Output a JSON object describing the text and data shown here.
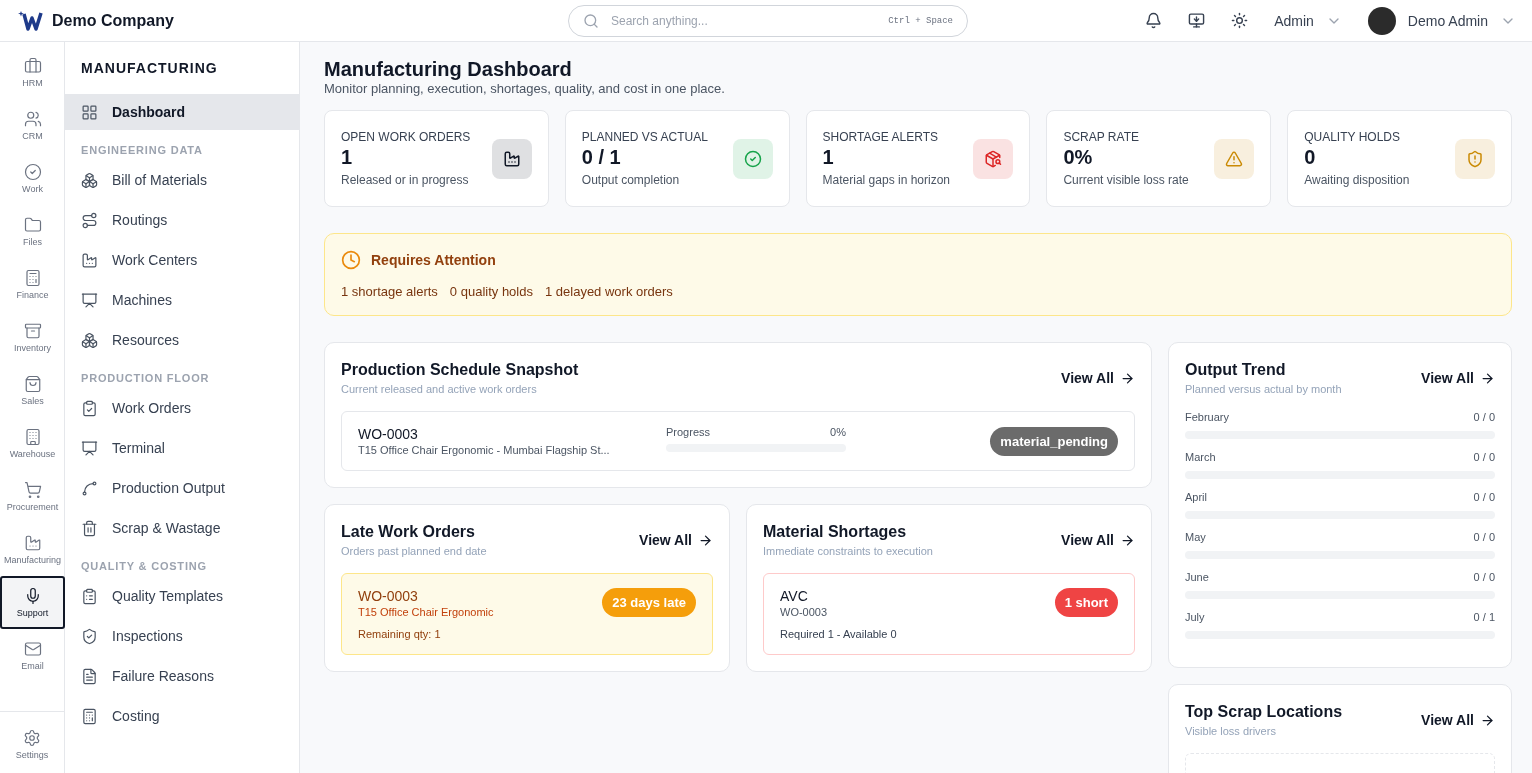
{
  "header": {
    "company": "Demo Company",
    "search": {
      "placeholder": "Search anything...",
      "shortcut": "Ctrl + Space"
    },
    "role": "Admin",
    "user": "Demo Admin"
  },
  "rail": [
    {
      "label": "HRM",
      "selected": false
    },
    {
      "label": "CRM",
      "selected": false
    },
    {
      "label": "Work",
      "selected": false
    },
    {
      "label": "Files",
      "selected": false
    },
    {
      "label": "Finance",
      "selected": false
    },
    {
      "label": "Inventory",
      "selected": false
    },
    {
      "label": "Sales",
      "selected": false
    },
    {
      "label": "Warehouse",
      "selected": false
    },
    {
      "label": "Procurement",
      "selected": false
    },
    {
      "label": "Manufacturing",
      "selected": false
    },
    {
      "label": "Support",
      "selected": true
    },
    {
      "label": "Email",
      "selected": false
    }
  ],
  "rail_footer": "Settings",
  "sidebar": {
    "title": "MANUFACTURING",
    "items": [
      {
        "kind": "item",
        "label": "Dashboard",
        "selected": true
      },
      {
        "kind": "section",
        "label": "ENGINEERING DATA"
      },
      {
        "kind": "item",
        "label": "Bill of Materials",
        "selected": false
      },
      {
        "kind": "item",
        "label": "Routings",
        "selected": false
      },
      {
        "kind": "item",
        "label": "Work Centers",
        "selected": false
      },
      {
        "kind": "item",
        "label": "Machines",
        "selected": false
      },
      {
        "kind": "item",
        "label": "Resources",
        "selected": false
      },
      {
        "kind": "section",
        "label": "PRODUCTION FLOOR"
      },
      {
        "kind": "item",
        "label": "Work Orders",
        "selected": false
      },
      {
        "kind": "item",
        "label": "Terminal",
        "selected": false
      },
      {
        "kind": "item",
        "label": "Production Output",
        "selected": false
      },
      {
        "kind": "item",
        "label": "Scrap & Wastage",
        "selected": false
      },
      {
        "kind": "section",
        "label": "QUALITY & COSTING"
      },
      {
        "kind": "item",
        "label": "Quality Templates",
        "selected": false
      },
      {
        "kind": "item",
        "label": "Inspections",
        "selected": false
      },
      {
        "kind": "item",
        "label": "Failure Reasons",
        "selected": false
      },
      {
        "kind": "item",
        "label": "Costing",
        "selected": false
      }
    ]
  },
  "page": {
    "title": "Manufacturing Dashboard",
    "subtitle": "Monitor planning, execution, shortages, quality, and cost in one place."
  },
  "stats": [
    {
      "label": "OPEN WORK ORDERS",
      "value": "1",
      "caption": "Released or in progress",
      "color": "#111827"
    },
    {
      "label": "PLANNED VS ACTUAL",
      "value": "0 / 1",
      "caption": "Output completion",
      "color": "#16a34a"
    },
    {
      "label": "SHORTAGE ALERTS",
      "value": "1",
      "caption": "Material gaps in horizon",
      "color": "#dc2626"
    },
    {
      "label": "SCRAP RATE",
      "value": "0%",
      "caption": "Current visible loss rate",
      "color": "#ca8a04"
    },
    {
      "label": "QUALITY HOLDS",
      "value": "0",
      "caption": "Awaiting disposition",
      "color": "#ca8a04"
    }
  ],
  "attention": {
    "title": "Requires Attention",
    "items": [
      "1 shortage alerts",
      "0 quality holds",
      "1 delayed work orders"
    ]
  },
  "schedule": {
    "title": "Production Schedule Snapshot",
    "subtitle": "Current released and active work orders",
    "link": "View All",
    "rows": [
      {
        "code": "WO-0003",
        "description": "T15 Office Chair Ergonomic - Mumbai Flagship St...",
        "progress_label": "Progress",
        "progress_value": "0%",
        "level": 0,
        "status": "material_pending"
      }
    ]
  },
  "late": {
    "title": "Late Work Orders",
    "subtitle": "Orders past planned end date",
    "link": "View All",
    "rows": [
      {
        "code": "WO-0003",
        "description": "T15 Office Chair Ergonomic",
        "remaining": "Remaining qty: 1",
        "badge": "23 days late"
      }
    ]
  },
  "shortages": {
    "title": "Material Shortages",
    "subtitle": "Immediate constraints to execution",
    "link": "View All",
    "rows": [
      {
        "material": "AVC",
        "order": "WO-0003",
        "detail": "Required 1 - Available 0",
        "badge": "1 short"
      }
    ]
  },
  "trend": {
    "title": "Output Trend",
    "subtitle": "Planned versus actual by month",
    "link": "View All",
    "rows": [
      {
        "month": "February",
        "reading": "0 / 0",
        "level": 0
      },
      {
        "month": "March",
        "reading": "0 / 0",
        "level": 0
      },
      {
        "month": "April",
        "reading": "0 / 0",
        "level": 0
      },
      {
        "month": "May",
        "reading": "0 / 0",
        "level": 0
      },
      {
        "month": "June",
        "reading": "0 / 0",
        "level": 0
      },
      {
        "month": "July",
        "reading": "0 / 1",
        "level": 0
      }
    ]
  },
  "scrap": {
    "title": "Top Scrap Locations",
    "subtitle": "Visible loss drivers",
    "link": "View All"
  }
}
